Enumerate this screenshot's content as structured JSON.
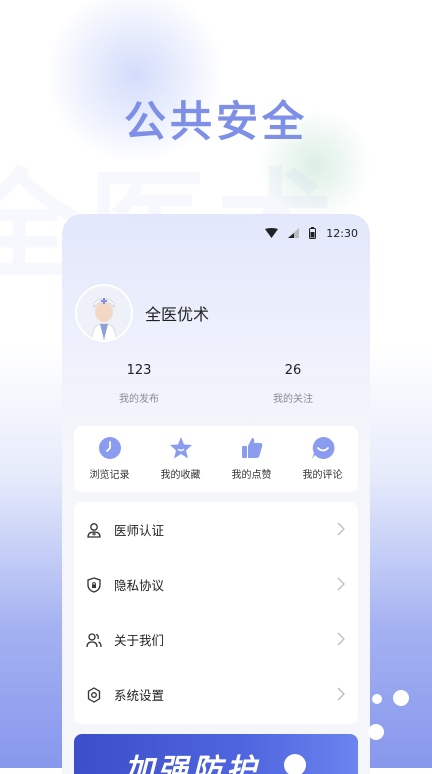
{
  "hero": {
    "title": "公共安全",
    "watermark": "全医术"
  },
  "status_bar": {
    "time": "12:30"
  },
  "profile": {
    "nickname": "全医优术"
  },
  "stats": [
    {
      "value": "123",
      "label": "我的发布"
    },
    {
      "value": "26",
      "label": "我的关注"
    }
  ],
  "quick_actions": [
    {
      "label": "浏览记录",
      "icon": "clock-icon"
    },
    {
      "label": "我的收藏",
      "icon": "star-icon"
    },
    {
      "label": "我的点赞",
      "icon": "thumbs-up-icon"
    },
    {
      "label": "我的评论",
      "icon": "comment-smile-icon"
    }
  ],
  "menu": [
    {
      "label": "医师认证",
      "icon": "doctor-badge-icon"
    },
    {
      "label": "隐私协议",
      "icon": "shield-lock-icon"
    },
    {
      "label": "关于我们",
      "icon": "users-icon"
    },
    {
      "label": "系统设置",
      "icon": "gear-icon"
    }
  ],
  "banner": {
    "text": "加强防护"
  },
  "colors": {
    "accent": "#7d8fe6",
    "icon_fill": "#8a9cf0",
    "banner": "#4356d1"
  }
}
